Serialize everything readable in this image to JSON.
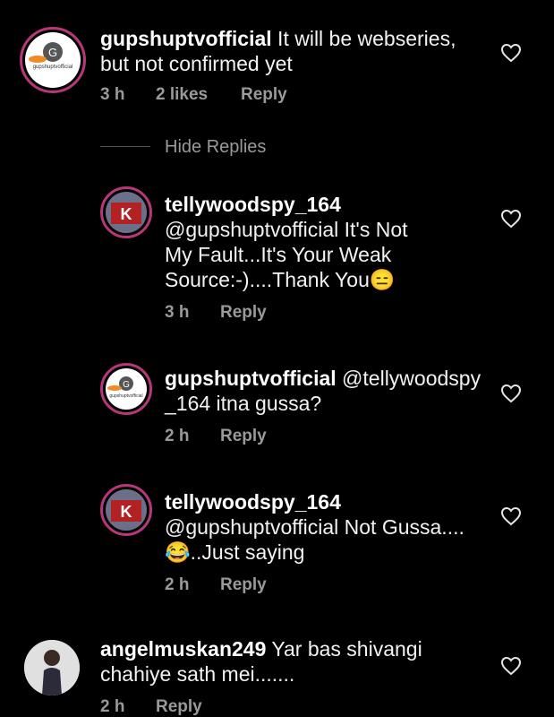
{
  "comments": [
    {
      "username": "gupshuptvofficial",
      "body": " It will be webseries, but not confirmed yet",
      "time": "3 h",
      "likes": "2 likes",
      "reply": "Reply",
      "avatar_label": "gupshuptvofficial",
      "avatar_letter": "G"
    },
    {
      "username": "tellywoodspy_164",
      "body": "@gupshuptvofficial It's Not My Fault...It's Your Weak Source:-)....Thank You",
      "emoji": "😑",
      "time": "3 h",
      "reply": "Reply",
      "avatar_letter": "K"
    },
    {
      "username": "gupshuptvofficial",
      "body": " @tellywoodspy _164 itna gussa?",
      "time": "2 h",
      "reply": "Reply",
      "avatar_label": "gupshuptvofficial",
      "avatar_letter": "G"
    },
    {
      "username": "tellywoodspy_164",
      "body": "@gupshuptvofficial Not Gussa....",
      "emoji": "😂",
      "body2": "..Just saying",
      "time": "2 h",
      "reply": "Reply",
      "avatar_letter": "K"
    },
    {
      "username": "angelmuskan249",
      "body": " Yar bas shivangi chahiye sath mei.......",
      "time": "2 h",
      "reply": "Reply"
    }
  ],
  "hide_replies": "Hide Replies",
  "icons": {
    "like": "heart-outline-icon"
  },
  "colors": {
    "background": "#000000",
    "secondary_text": "#9a9a9a",
    "story_ring": "#b8377a"
  }
}
